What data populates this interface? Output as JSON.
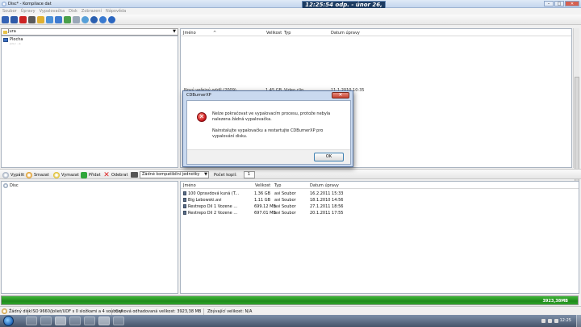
{
  "window": {
    "title": "Disc* - Kompilace dat",
    "clock": "12:25:54 odp. - únor 26, 2011"
  },
  "menu": [
    "Soubor",
    "Úpravy",
    "Vypalovačka",
    "Disk",
    "Zobrazení",
    "Nápověda"
  ],
  "toolbar": {
    "icons": [
      "new-icon",
      "save-icon",
      "delete-icon",
      "print-icon",
      "folder-icon",
      "properties-icon",
      "drive-icon",
      "network-icon",
      "eject-icon",
      "refresh-icon",
      "info-icon",
      "help-icon",
      "about-icon"
    ],
    "colors": [
      "#3563b5",
      "#2f5aa8",
      "#cc2222",
      "#5a5a5a",
      "#e0b030",
      "#4a8fd8",
      "#3f7bd0",
      "#4aa04a",
      "#9aa8b8",
      "#57a0d8",
      "#2a5fb0",
      "#3a7ad0",
      "#2b66c0"
    ]
  },
  "top_left": {
    "folder": "Jura",
    "tree": [
      {
        "label": "Plocha",
        "sub": "Jura / ...a"
      }
    ]
  },
  "top_right": {
    "columns": [
      "Jméno",
      "Velikost",
      "Typ",
      "Datum úpravy"
    ],
    "partial_row": {
      "name": "Nový veřejný oddíl (2009)",
      "size": "1.45 GB",
      "type": "Video clip",
      "date": "11.1.2010 10:35"
    }
  },
  "dialog": {
    "title": "CDBurnerXP",
    "close": "✕",
    "message1": "Nelze pokračovat ve vypalovacím procesu, protože nebyla nalezena žádná vypalovačka.",
    "message2": "Nainstalujte vypalovačku a restartujte CDBurnerXP pro vypalování disku.",
    "ok": "OK"
  },
  "midbar": {
    "burn": "Vypálit",
    "erase": "Smazat",
    "clear": "Vymazat",
    "add": "Přidat",
    "remove": "Odebrat",
    "drive": "Žádné kompatibilní jednotky",
    "copies_label": "Počet kopií:",
    "copies": "1"
  },
  "bottom_left": {
    "tree": [
      "Disc"
    ]
  },
  "bottom_right": {
    "columns": [
      "Jméno",
      "Velikost",
      "Typ",
      "Datum úpravy"
    ],
    "rows": [
      {
        "name": "100 Opravdová kuná (T...",
        "size": "1.36 GB",
        "type": "avi Soubor",
        "date": "16.2.2011 15:33"
      },
      {
        "name": "Big Lebowski.avi",
        "size": "1.11 GB",
        "type": "avi Soubor",
        "date": "18.1.2010 14:56"
      },
      {
        "name": "Restrepo Dil 1 Vozene ...",
        "size": "699.12 MB",
        "type": "avi Soubor",
        "date": "27.1.2011 18:56"
      },
      {
        "name": "Restrepo Dil 2 Vozene ...",
        "size": "697.01 MB",
        "type": "avi Soubor",
        "date": "20.1.2011 17:55"
      }
    ]
  },
  "progress": {
    "label": "3923,38MB",
    "fraction": 1.0
  },
  "status": {
    "disk": "Žádný disk",
    "fs": "ISO 9660/Joliet/UDF s 0 složkami a 4 soubory",
    "total": "Celková odhadovaná velikost: 3923,38 MB",
    "remaining": "Zbývající velikost: N/A"
  },
  "taskbar": {
    "time": "12:25"
  }
}
